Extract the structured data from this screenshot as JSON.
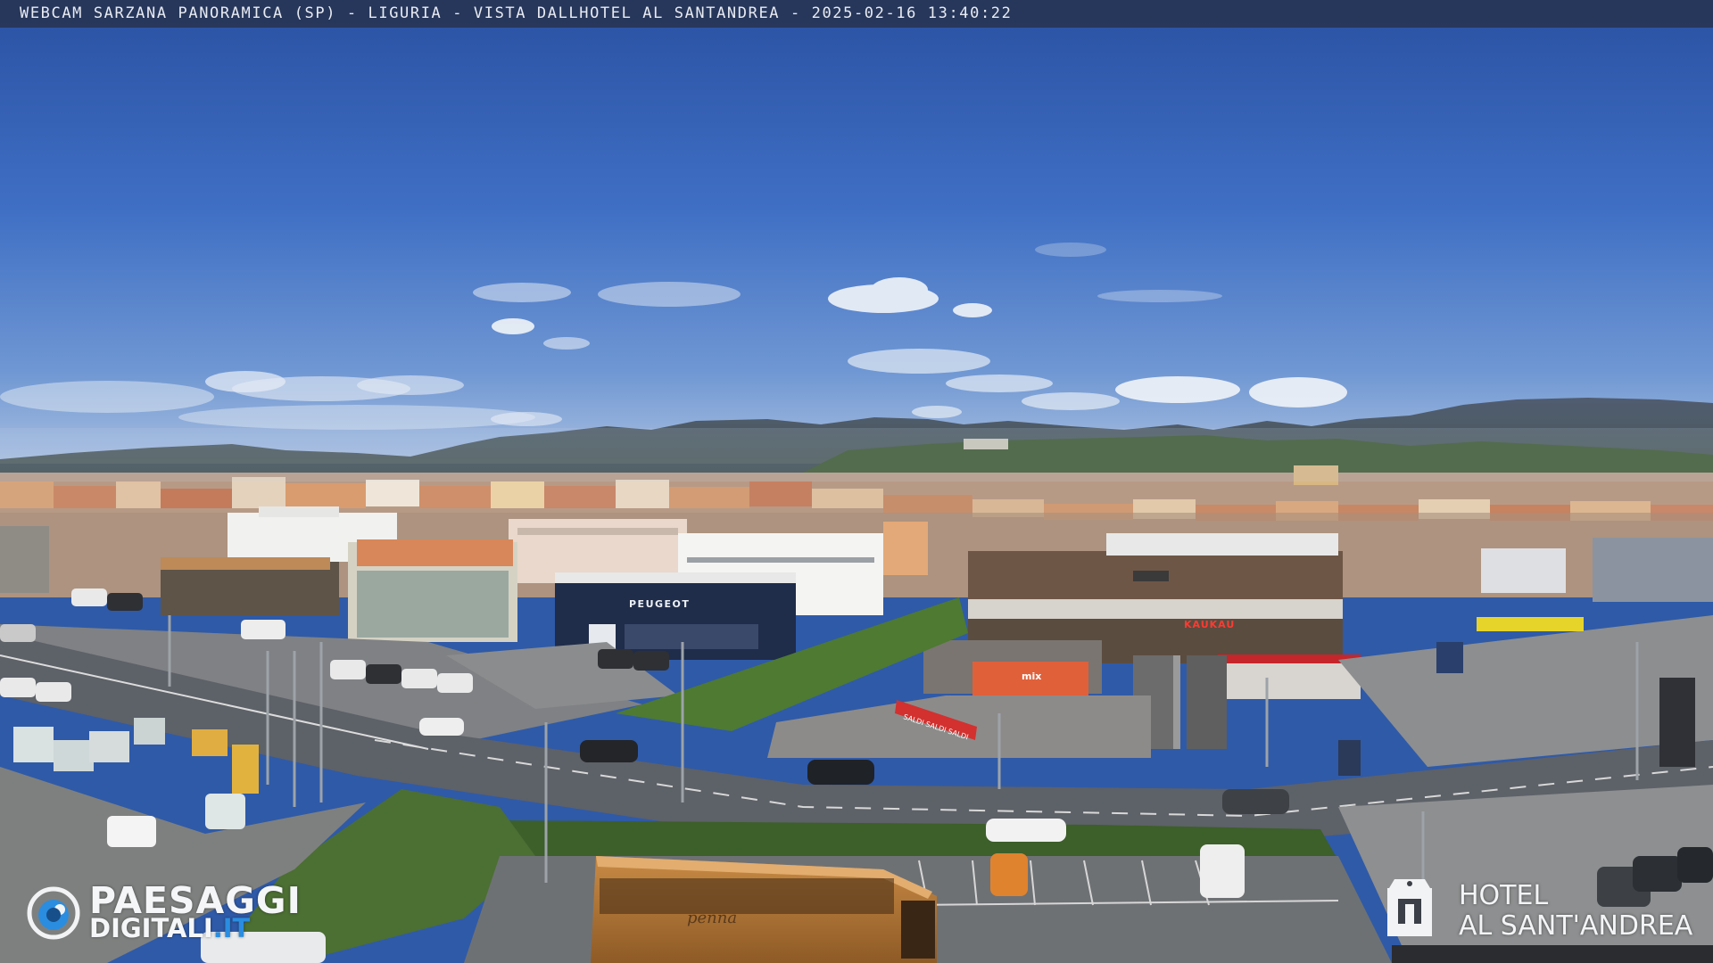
{
  "header": {
    "caption": "WEBCAM SARZANA PANORAMICA (SP) - LIGURIA - VISTA DALLHOTEL AL SANTANDREA - 2025-02-16  13:40:22"
  },
  "watermark_left": {
    "brand_line1": "PAESAGGI",
    "brand_line2_word": "DIGITALI",
    "brand_line2_tld": ".IT"
  },
  "watermark_right": {
    "line1": "HOTEL",
    "line2": "AL SANT'ANDREA"
  },
  "signage": {
    "dealer": "PEUGEOT",
    "store": "KAUKAU",
    "shop_sign": "mix",
    "banner": "SALDI SALDI SALDI",
    "bus_brand": "penna"
  },
  "colors": {
    "sky_top": "#2d55a6",
    "sky_mid": "#4a7fcf",
    "sky_horizon": "#9db7dc",
    "road": "#5d6168",
    "grass": "#4e7a32",
    "caption_bar": "#263046",
    "brand_blue": "#2a8de0"
  }
}
